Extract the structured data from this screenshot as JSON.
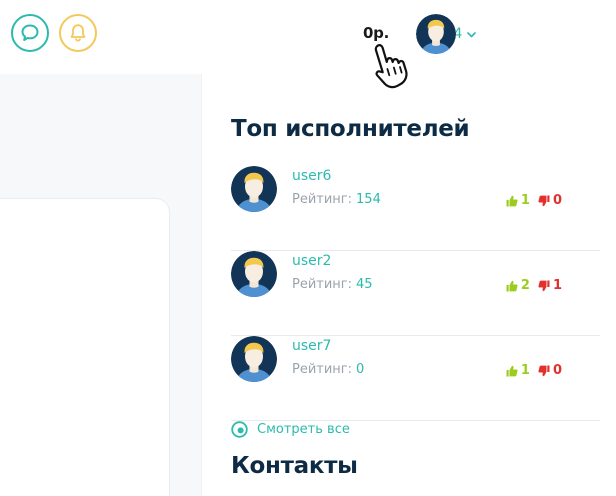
{
  "header": {
    "balance": "0р.",
    "username": "user4"
  },
  "sidebar_right": {
    "top_title": "Топ исполнителей",
    "rating_label": "Рейтинг:",
    "performers": [
      {
        "name": "user6",
        "rating": "154",
        "likes": "1",
        "dislikes": "0"
      },
      {
        "name": "user2",
        "rating": "45",
        "likes": "2",
        "dislikes": "1"
      },
      {
        "name": "user7",
        "rating": "0",
        "likes": "1",
        "dislikes": "0"
      }
    ],
    "see_all_label": "Смотреть все",
    "contacts_title": "Контакты"
  },
  "colors": {
    "accent": "#2bbbad",
    "notification": "#f4c85a",
    "like": "#9ccc1e",
    "dislike": "#e0312c",
    "heading": "#0d2b45"
  },
  "icons": [
    "chat-icon",
    "bell-icon",
    "chevron-down-icon",
    "hand-cursor-icon",
    "thumbs-up-icon",
    "thumbs-down-icon",
    "eye-icon"
  ]
}
